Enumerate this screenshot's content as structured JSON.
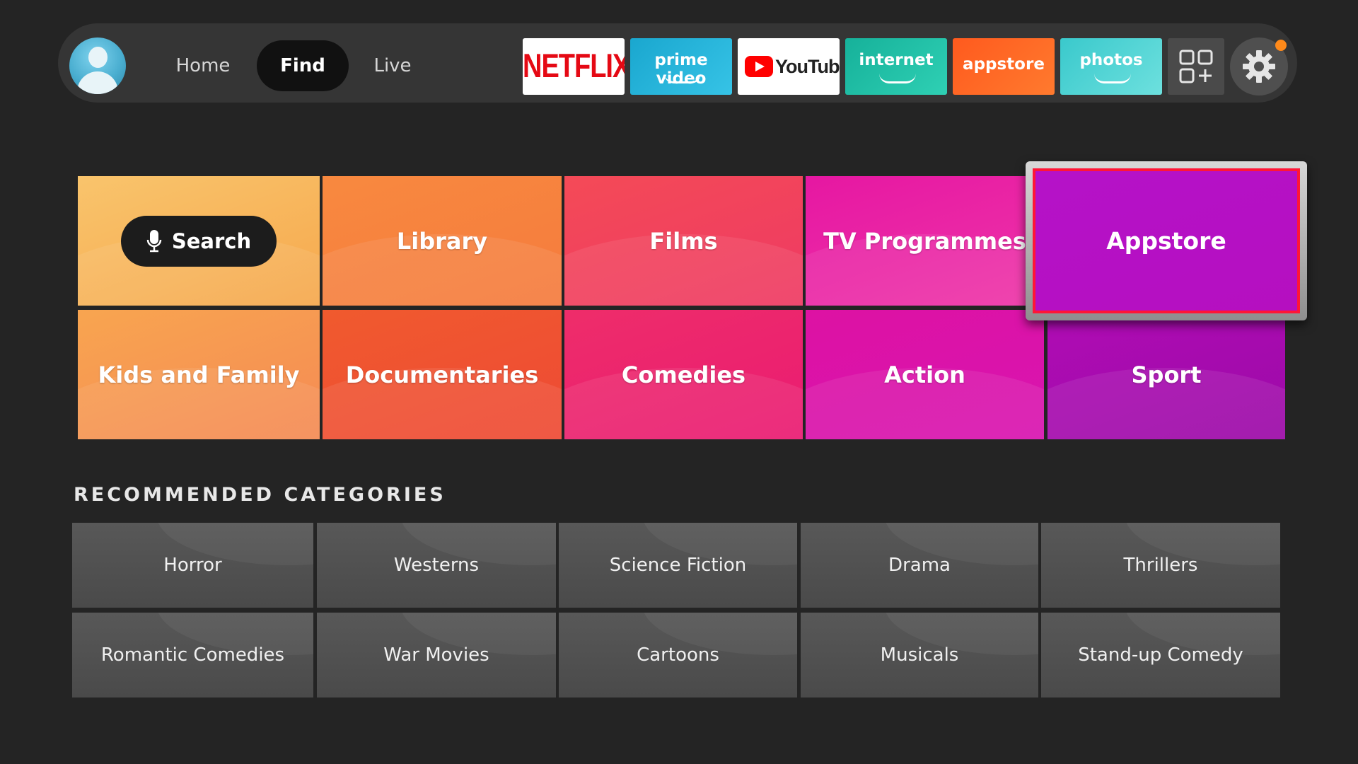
{
  "nav": {
    "home": "Home",
    "find": "Find",
    "live": "Live"
  },
  "apps": {
    "netflix": "NETFLIX",
    "prime_video": "prime video",
    "youtube": "YouTube",
    "internet": "internet",
    "appstore": "appstore",
    "photos": "photos"
  },
  "icons": {
    "avatar": "profile-avatar",
    "apps_grid": "apps-grid-plus-icon",
    "settings": "gear-icon",
    "mic": "microphone-icon"
  },
  "colors": {
    "focus_border": "#ff1636",
    "notification_dot": "#ff8a1a"
  },
  "categories": {
    "search": "Search",
    "library": "Library",
    "films": "Films",
    "tv_programmes": "TV Programmes",
    "appstore": "Appstore",
    "kids_and_family": "Kids and Family",
    "documentaries": "Documentaries",
    "comedies": "Comedies",
    "action": "Action",
    "sport": "Sport"
  },
  "recommended": {
    "title": "RECOMMENDED CATEGORIES",
    "items": [
      "Horror",
      "Westerns",
      "Science Fiction",
      "Drama",
      "Thrillers",
      "Romantic Comedies",
      "War Movies",
      "Cartoons",
      "Musicals",
      "Stand-up Comedy"
    ]
  }
}
